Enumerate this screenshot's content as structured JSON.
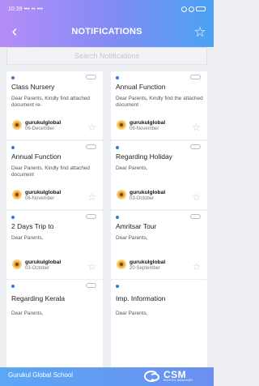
{
  "status_bar": {
    "time": "10:39",
    "signals": "••• •• •••"
  },
  "header": {
    "title": "NOTIFICATIONS",
    "back_icon": "back-chevron-icon",
    "star_icon": "star-outline-icon"
  },
  "search": {
    "placeholder": "Search Notifications"
  },
  "notifications": [
    {
      "title": "Class Nursery",
      "body": "Dear Parents, Kindly find attached document re-",
      "author": "gurukulglobal",
      "date": "06-December"
    },
    {
      "title": "Annual Function",
      "body": "Dear Parents, Kindly find the attached document",
      "author": "gurukulglobal",
      "date": "06-November"
    },
    {
      "title": "Annual Function",
      "body": "Dear Parents, Kindly find attached document",
      "author": "gurukulglobal",
      "date": "06-November"
    },
    {
      "title": "Regarding Holiday",
      "body": "Dear Parents,",
      "author": "gurukulglobal",
      "date": "03-October"
    },
    {
      "title": "2 Days Trip to",
      "body": "Dear Parents,",
      "author": "gurukulglobal",
      "date": "03-October"
    },
    {
      "title": "Amritsar Tour",
      "body": "Dear Parents,",
      "author": "gurukulglobal",
      "date": "20-September"
    },
    {
      "title": "Regarding Kerala",
      "body": "Dear Parents,",
      "author": "",
      "date": ""
    },
    {
      "title": "Imp. Information",
      "body": "Dear Parents,",
      "author": "",
      "date": ""
    }
  ],
  "footer": {
    "school": "Gurukul Global School",
    "brand": "CSM",
    "brand_sub": "SCHOOL MANAGER"
  },
  "colors": {
    "header_start": "#b58cf7",
    "header_end": "#4ba3f3",
    "accent": "#2f7de0",
    "logo": "#e6a92b"
  }
}
